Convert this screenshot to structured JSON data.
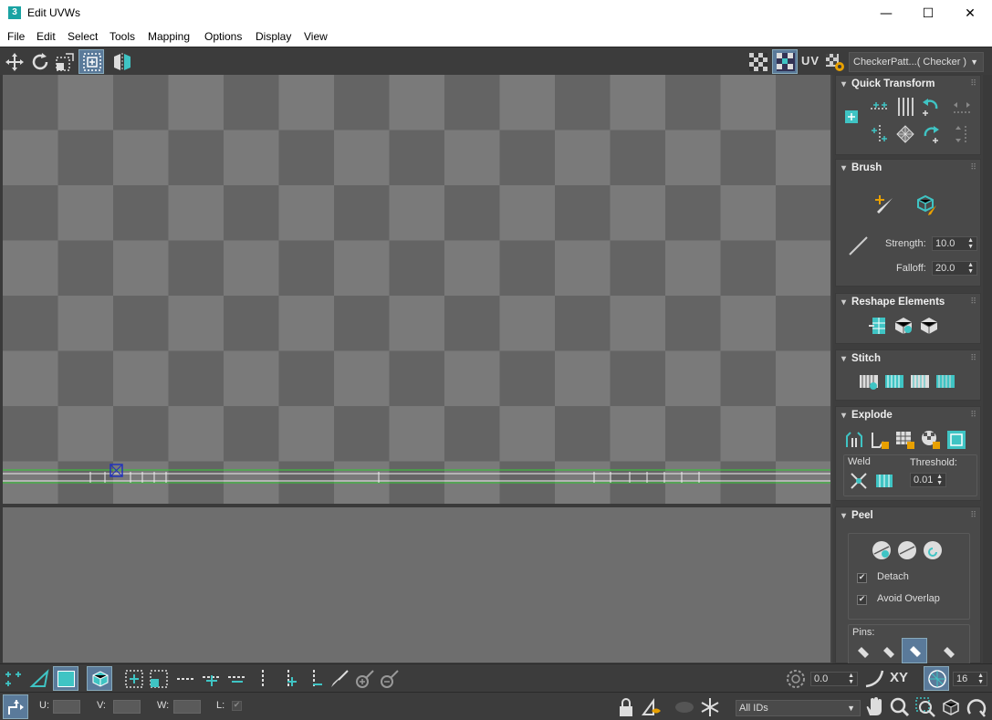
{
  "window": {
    "app_icon": "3",
    "title": "Edit UVWs",
    "minimize": "—",
    "maximize": "☐",
    "close": "✕"
  },
  "menu": [
    "File",
    "Edit",
    "Select",
    "Tools",
    "Mapping",
    "Options",
    "Display",
    "View"
  ],
  "toolbar": {
    "uv_label": "UV",
    "texture_dropdown": "CheckerPatt...( Checker )"
  },
  "panel": {
    "quick_transform": {
      "title": "Quick Transform"
    },
    "brush": {
      "title": "Brush",
      "strength_label": "Strength:",
      "strength_value": "10.0",
      "falloff_label": "Falloff:",
      "falloff_value": "20.0"
    },
    "reshape": {
      "title": "Reshape Elements"
    },
    "stitch": {
      "title": "Stitch"
    },
    "explode": {
      "title": "Explode",
      "weld_label": "Weld",
      "threshold_label": "Threshold:",
      "threshold_value": "0.01"
    },
    "peel": {
      "title": "Peel",
      "detach_label": "Detach",
      "avoid_overlap_label": "Avoid Overlap",
      "pins_label": "Pins:"
    }
  },
  "bottom": {
    "angle_value": "0.0",
    "xy_label": "XY",
    "grid_value": "16",
    "u_label": "U:",
    "v_label": "V:",
    "w_label": "W:",
    "l_label": "L:",
    "all_ids": "All IDs"
  },
  "colors": {
    "accent": "#3fc4c4",
    "uv_green": "#33cc33",
    "selection_blue": "#2233bb"
  }
}
